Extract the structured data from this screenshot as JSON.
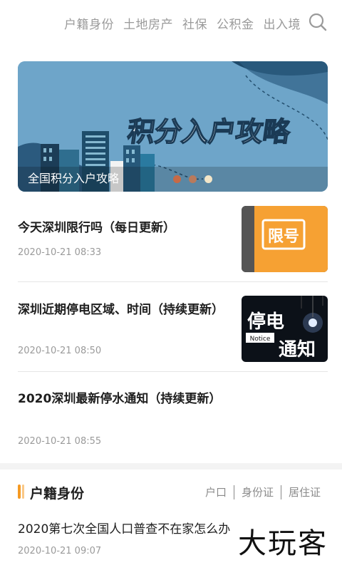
{
  "topnav": {
    "tabs": [
      "户籍身份",
      "土地房产",
      "社保",
      "公积金",
      "出入境"
    ],
    "search_icon": "search-icon"
  },
  "banner": {
    "art_text": "积分入户攻略",
    "caption": "全国积分入户攻略",
    "dot_colors": [
      "#c76a46",
      "#b97a5c",
      "#f3e6c8"
    ],
    "bg_color": "#6ea5c9"
  },
  "news": [
    {
      "title": "今天深圳限行吗（每日更新）",
      "date": "2020-10-21 08:33",
      "thumb_text": "限号"
    },
    {
      "title": "深圳近期停电区域、时间（持续更新）",
      "date": "2020-10-21 08:50",
      "thumb_text": "停电通知",
      "thumb_sub": "Notice"
    },
    {
      "title": "2020深圳最新停水通知（持续更新）",
      "date": "2020-10-21 08:55"
    }
  ],
  "section": {
    "title": "户籍身份",
    "subtabs": [
      "户口",
      "身份证",
      "居住证"
    ]
  },
  "last_news": {
    "title": "2020第七次全国人口普查不在家怎么办",
    "date": "2020-10-21 09:07"
  },
  "watermark": "大玩客",
  "colors": {
    "accent": "#f59a23",
    "muted": "#9a9a9a"
  }
}
